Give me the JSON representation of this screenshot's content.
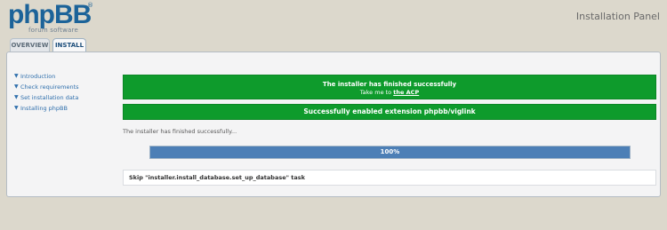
{
  "header": {
    "logo_text": "phpBB",
    "logo_subtext": "forum software",
    "logo_mark": "®",
    "panel_title": "Installation Panel"
  },
  "tabs": [
    {
      "label": "OVERVIEW",
      "active": false
    },
    {
      "label": "INSTALL",
      "active": true
    }
  ],
  "sidebar": {
    "items": [
      {
        "label": "Introduction",
        "icon": "chevron-down-icon"
      },
      {
        "label": "Check requirements",
        "icon": "chevron-down-icon"
      },
      {
        "label": "Set installation data",
        "icon": "chevron-down-icon"
      },
      {
        "label": "Installing phpBB",
        "icon": "chevron-down-icon"
      }
    ]
  },
  "main": {
    "success": {
      "title": "The installer has finished successfully",
      "sub_prefix": "Take me to ",
      "link_label": "the ACP"
    },
    "extension_message": "Successfully enabled extension phpbb/viglink",
    "status_text": "The installer has finished successfully...",
    "progress": {
      "percent": 100,
      "label": "100%"
    },
    "log_message": "Skip \"installer.install_database.set_up_database\" task"
  },
  "colors": {
    "success_green": "#0e9b2c",
    "progress_blue": "#4c7fb6",
    "link_blue": "#2f6fac",
    "page_bg": "#dcd8cc"
  }
}
